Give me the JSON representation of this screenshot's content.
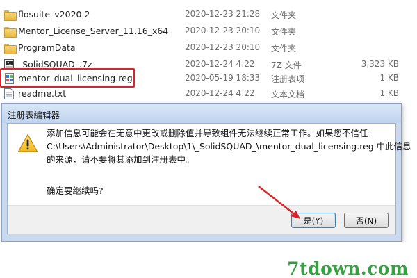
{
  "files": [
    {
      "name": "flosuite_v2020.2",
      "date": "2020-12-23 21:28",
      "type": "文件夹",
      "size": "",
      "icon": "folder-icon"
    },
    {
      "name": "Mentor_License_Server_11.16_x64",
      "date": "2020-12-23 20:10",
      "type": "文件夹",
      "size": "",
      "icon": "folder-icon"
    },
    {
      "name": "ProgramData",
      "date": "2020-12-23 20:10",
      "type": "文件夹",
      "size": "",
      "icon": "folder-icon"
    },
    {
      "name": "_SolidSQUAD_.7z",
      "date": "2020-12-24 4:22",
      "type": "7Z 文件",
      "size": "3,323 KB",
      "icon": "archive-icon"
    },
    {
      "name": "mentor_dual_licensing.reg",
      "date": "2020-05-19 18:33",
      "type": "注册表项",
      "size": "1 KB",
      "icon": "registry-file-icon"
    },
    {
      "name": "readme.txt",
      "date": "2020-12-24 4:22",
      "type": "文本文档",
      "size": "1 KB",
      "icon": "text-file-icon"
    }
  ],
  "dialog": {
    "title": "注册表编辑器",
    "message_lines": [
      "添加信息可能会在无意中更改或删除值并导致组件无法继续正常工作。如果您不信任",
      "C:\\Users\\Administrator\\Desktop\\1\\_SolidSQUAD_\\mentor_dual_licensing.reg 中此信息",
      "的来源，请不要将其添加到注册表中。"
    ],
    "confirm": "确定要继续吗?",
    "yes_label": "是(Y)",
    "no_label": "否(N)"
  },
  "watermark": "7tdown.com",
  "colors": {
    "highlight": "#d6262b",
    "arrow": "#d6262b",
    "watermark": "#36a042",
    "dialog_frame": "#c9daf0"
  }
}
